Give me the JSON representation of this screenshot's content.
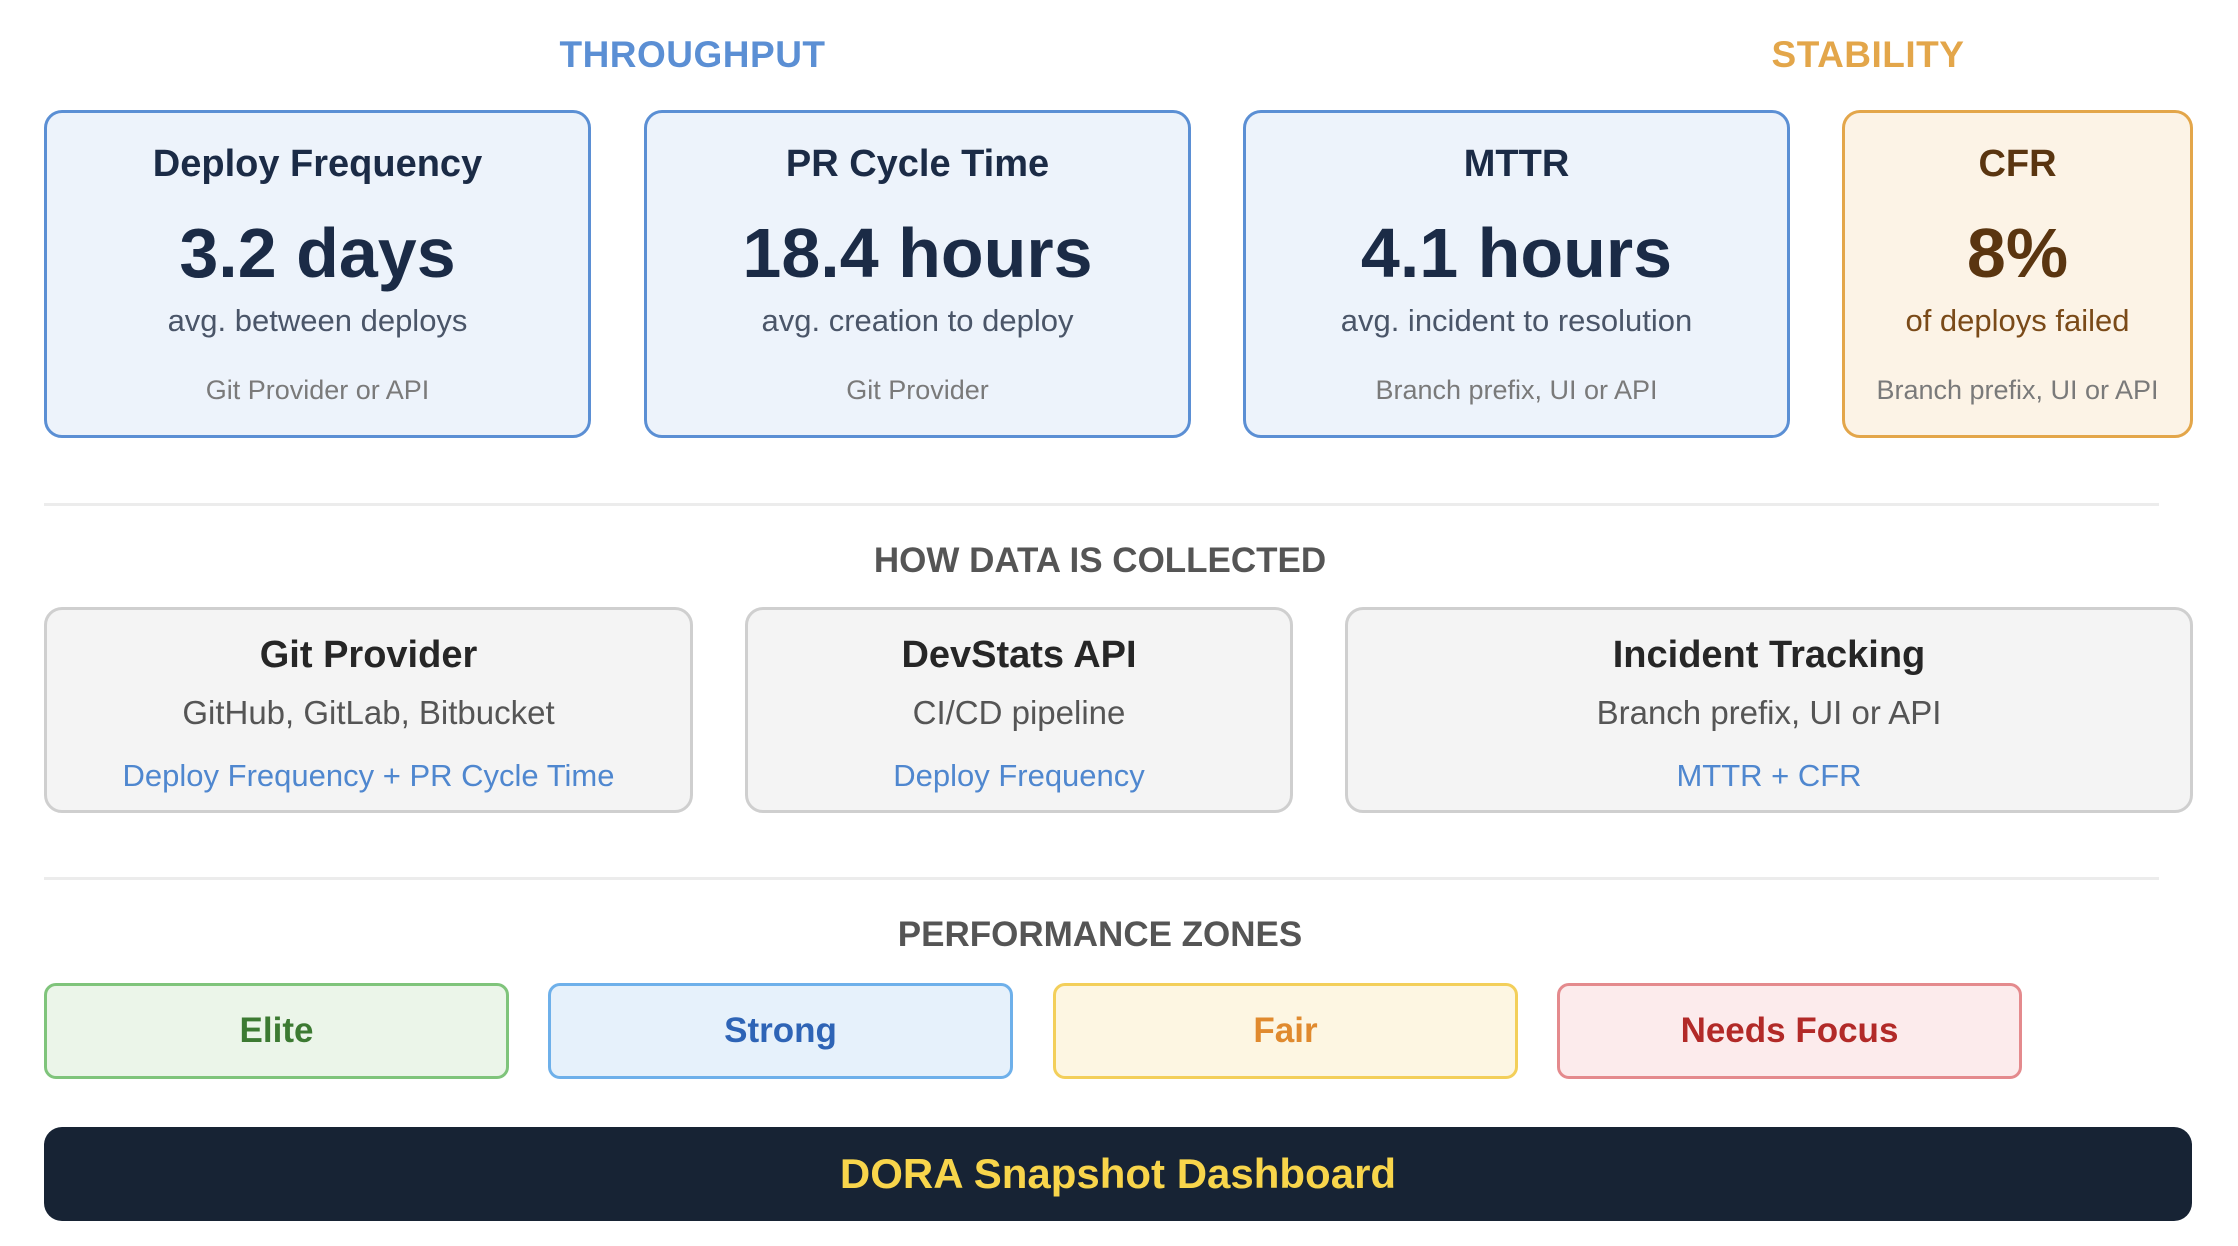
{
  "groups": {
    "throughput": "THROUGHPUT",
    "stability": "STABILITY"
  },
  "metrics": [
    {
      "title": "Deploy Frequency",
      "value": "3.2 days",
      "subtitle": "avg. between deploys",
      "source": "Git Provider or API"
    },
    {
      "title": "PR Cycle Time",
      "value": "18.4 hours",
      "subtitle": "avg. creation to deploy",
      "source": "Git Provider"
    },
    {
      "title": "MTTR",
      "value": "4.1 hours",
      "subtitle": "avg. incident to resolution",
      "source": "Branch prefix, UI or API"
    },
    {
      "title": "CFR",
      "value": "8%",
      "subtitle": "of deploys failed",
      "source": "Branch prefix, UI or API"
    }
  ],
  "collection": {
    "title": "HOW DATA IS COLLECTED",
    "sources": [
      {
        "title": "Git Provider",
        "subtitle": "GitHub, GitLab, Bitbucket",
        "metrics": "Deploy Frequency + PR Cycle Time"
      },
      {
        "title": "DevStats API",
        "subtitle": "CI/CD pipeline",
        "metrics": "Deploy Frequency"
      },
      {
        "title": "Incident Tracking",
        "subtitle": "Branch prefix, UI or API",
        "metrics": "MTTR + CFR"
      }
    ]
  },
  "zones": {
    "title": "PERFORMANCE ZONES",
    "items": [
      "Elite",
      "Strong",
      "Fair",
      "Needs Focus"
    ]
  },
  "banner": "DORA Snapshot Dashboard",
  "colors": {
    "throughput_accent": "#5b8fd4",
    "stability_accent": "#e3a64a",
    "banner_bg": "#172334",
    "banner_text": "#f8d54b"
  }
}
